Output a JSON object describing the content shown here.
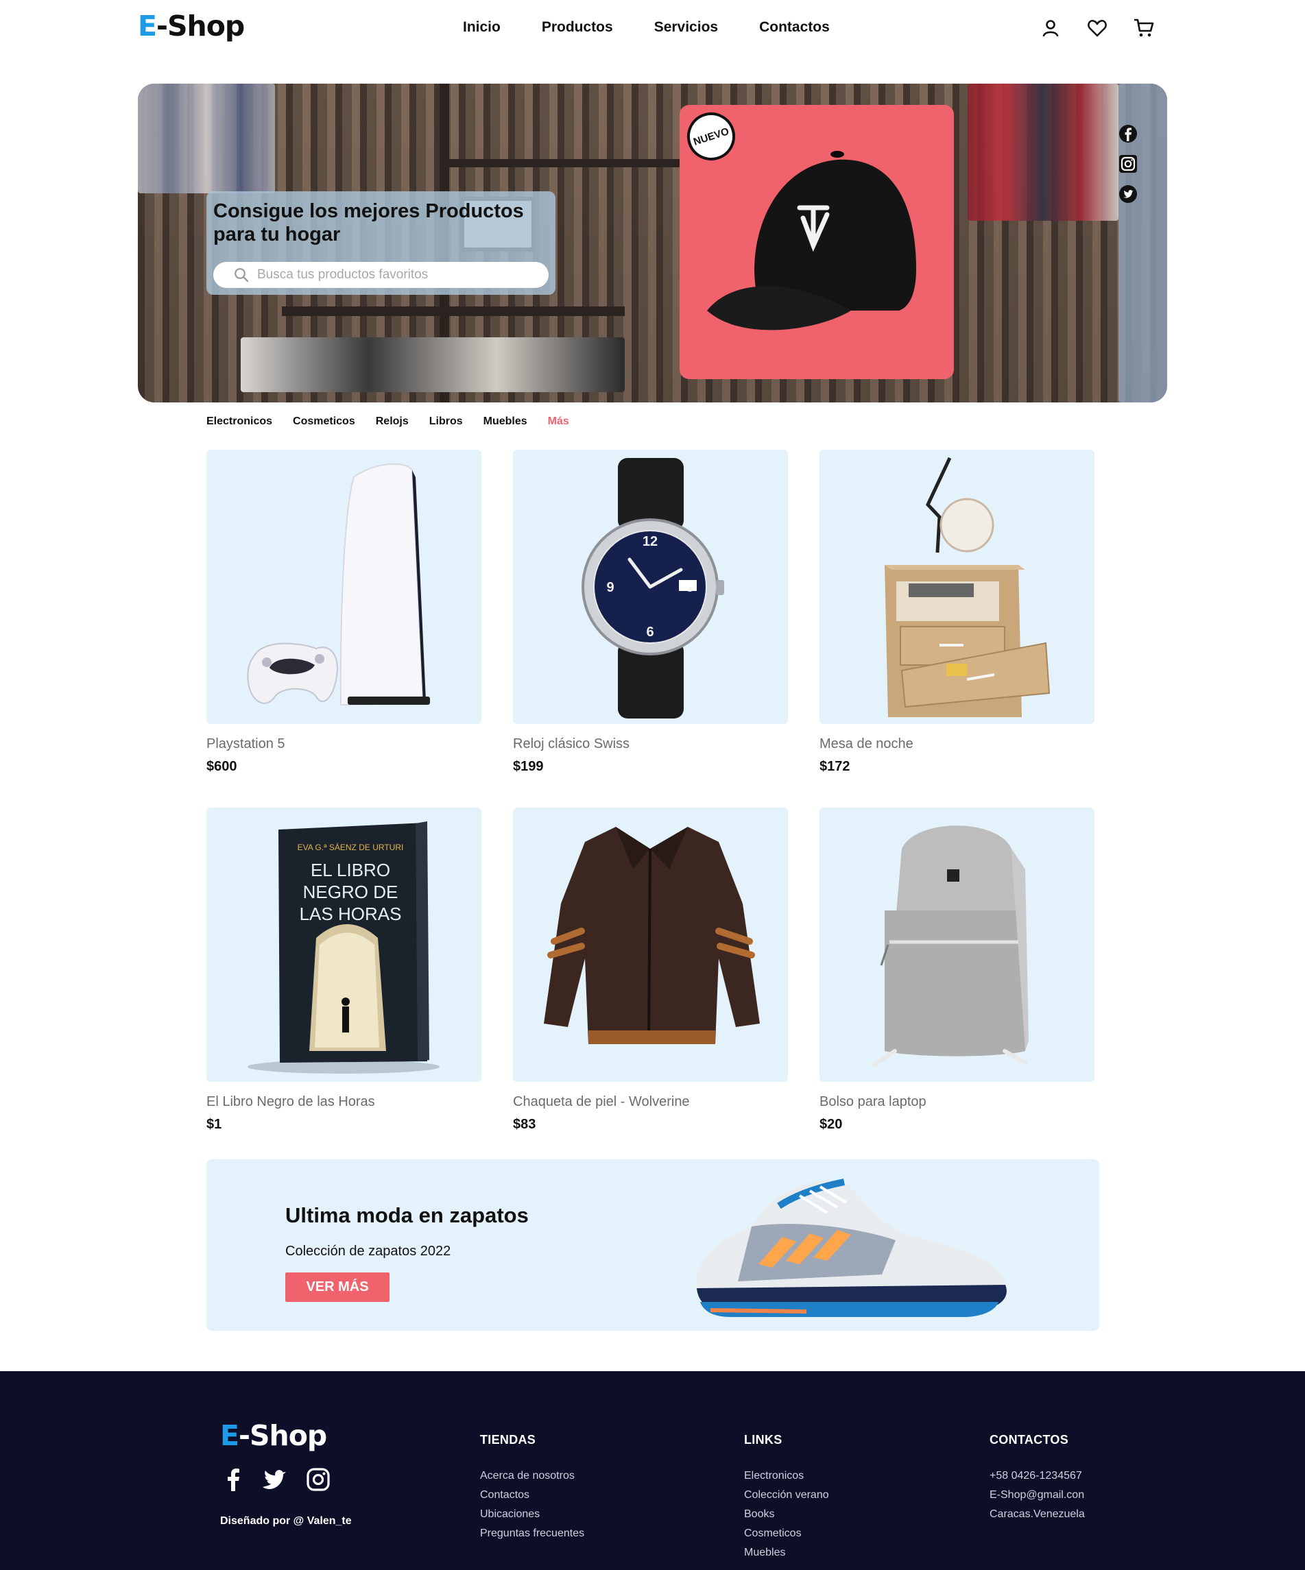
{
  "brand": {
    "logo_e": "E",
    "logo_rest": "-Shop"
  },
  "nav": {
    "items": [
      {
        "label": "Inicio"
      },
      {
        "label": "Productos"
      },
      {
        "label": "Servicios"
      },
      {
        "label": "Contactos"
      }
    ],
    "icons": [
      "user-icon",
      "heart-icon",
      "cart-icon"
    ]
  },
  "hero": {
    "title": "Consigue los mejores Productos para tu hogar",
    "search_placeholder": "Busca tus productos favoritos",
    "badge": "NUEVO",
    "socials": [
      "facebook-icon",
      "instagram-icon",
      "twitter-icon"
    ]
  },
  "categories": [
    {
      "label": "Electronicos"
    },
    {
      "label": "Cosmeticos"
    },
    {
      "label": "Relojs"
    },
    {
      "label": "Libros"
    },
    {
      "label": "Muebles"
    },
    {
      "label": "Más"
    }
  ],
  "products": [
    {
      "name": "Playstation 5",
      "price": "$600"
    },
    {
      "name": "Reloj clásico Swiss",
      "price": "$199"
    },
    {
      "name": "Mesa de noche",
      "price": "$172"
    },
    {
      "name": "El Libro Negro de las Horas",
      "price": "$1"
    },
    {
      "name": "Chaqueta de piel - Wolverine",
      "price": "$83"
    },
    {
      "name": "Bolso para laptop",
      "price": "$20"
    }
  ],
  "book_cover": {
    "author": "EVA G.ª SÁENZ DE URTURI",
    "line1": "EL LIBRO",
    "line2": "NEGRO DE",
    "line3": "LAS HORAS"
  },
  "banner": {
    "title": "Ultima moda en zapatos",
    "subtitle": "Colección de zapatos 2022",
    "button": "VER MÁS"
  },
  "footer": {
    "credit": "Diseñado por @ Valen_te",
    "tiendas": {
      "title": "TIENDAS",
      "links": [
        "Acerca de nosotros",
        "Contactos",
        "Ubicaciones",
        "Preguntas frecuentes"
      ]
    },
    "links": {
      "title": "LINKS",
      "links": [
        "Electronicos",
        "Colección verano",
        "Books",
        "Cosmeticos",
        "Muebles"
      ]
    },
    "contactos": {
      "title": "CONTACTOS",
      "lines": [
        "+58 0426-1234567",
        "E-Shop@gmail.con",
        "Caracas.Venezuela"
      ]
    }
  },
  "colors": {
    "accent": "#f0626c",
    "brand_blue": "#1d9be8",
    "card_bg": "#e4f2fc",
    "footer_bg": "#0c0f27"
  }
}
